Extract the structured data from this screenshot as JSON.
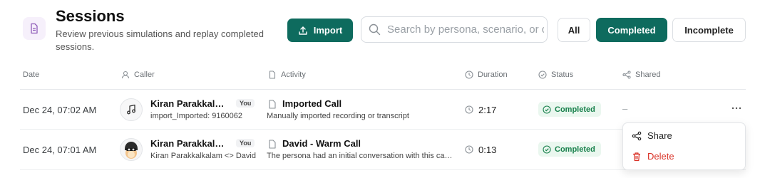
{
  "header": {
    "title": "Sessions",
    "subtitle": "Review previous simulations and replay completed sessions.",
    "import_label": "Import",
    "search_placeholder": "Search by persona, scenario, or caller",
    "filters": [
      "All",
      "Completed",
      "Incomplete"
    ],
    "active_filter": "Completed"
  },
  "columns": [
    "Date",
    "Caller",
    "Activity",
    "Duration",
    "Status",
    "Shared"
  ],
  "rows": [
    {
      "date": "Dec 24, 07:02 AM",
      "caller_name": "Kiran Parakkalkalam",
      "you_badge": "You",
      "caller_sub": "import_Imported: 9160062",
      "activity_title": "Imported Call",
      "activity_sub": "Manually imported recording or transcript",
      "duration": "2:17",
      "status": "Completed",
      "shared": "–",
      "avatar_icon": "music-note-icon"
    },
    {
      "date": "Dec 24, 07:01 AM",
      "caller_name": "Kiran Parakkalkalam",
      "you_badge": "You",
      "caller_sub": "Kiran Parakkalkalam <> David",
      "activity_title": "David - Warm Call",
      "activity_sub": "The persona had an initial conversation with this caller",
      "duration": "0:13",
      "status": "Completed",
      "avatar_icon": "persona-avatar-image"
    }
  ],
  "menu": {
    "share_label": "Share",
    "delete_label": "Delete"
  },
  "colors": {
    "accent": "#0e6b5e",
    "status_bg": "#eaf7ef",
    "status_text": "#17804b",
    "danger": "#d93025"
  }
}
